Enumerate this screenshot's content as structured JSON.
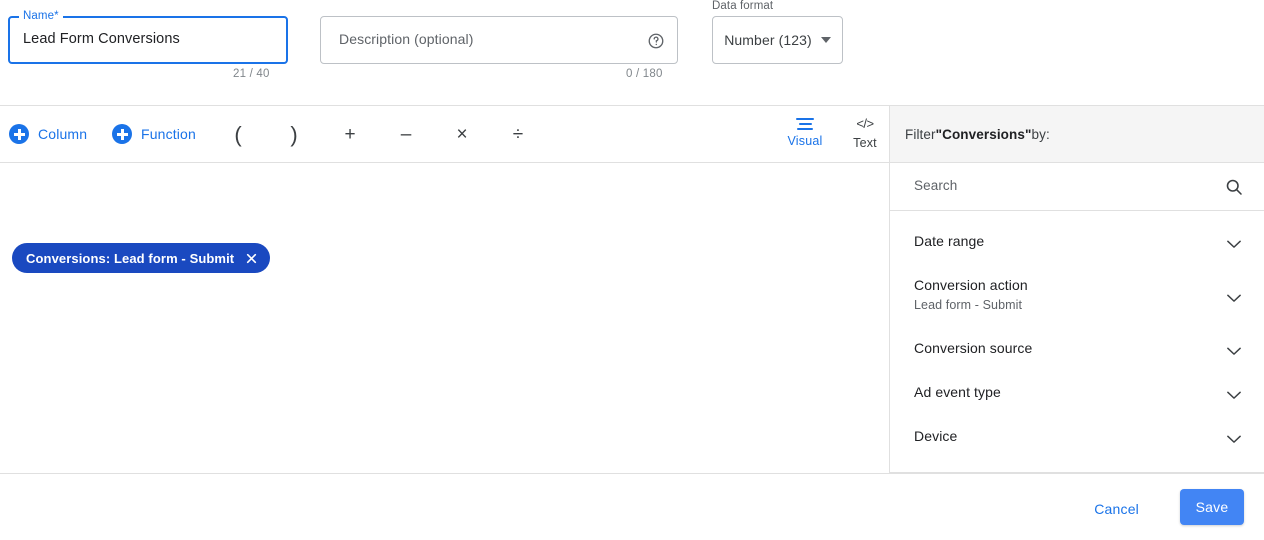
{
  "form": {
    "name_field": {
      "label": "Name*",
      "value": "Lead Form Conversions",
      "counter": "21 / 40"
    },
    "description_field": {
      "placeholder": "Description (optional)",
      "counter": "0 / 180",
      "help_icon": "help-circle-icon"
    },
    "data_format": {
      "label": "Data format",
      "selected": "Number (123)"
    }
  },
  "toolbar": {
    "add_column_label": "Column",
    "add_function_label": "Function",
    "operators": [
      "(",
      ")",
      "+",
      "–",
      "×",
      "÷"
    ],
    "modes": [
      {
        "label": "Visual",
        "icon": "visual-lines-icon",
        "active": true
      },
      {
        "label": "Text",
        "icon": "code-brackets-icon",
        "active": false
      }
    ]
  },
  "editor": {
    "chips": [
      {
        "label": "Conversions: Lead form - Submit",
        "remove_icon": "close-icon"
      }
    ]
  },
  "filter_panel": {
    "header_prefix": "Filter ",
    "header_subject": "\"Conversions\"",
    "header_suffix": " by:",
    "search": {
      "placeholder": "Search",
      "icon": "search-icon"
    },
    "items": [
      {
        "title": "Date range",
        "subtitle": ""
      },
      {
        "title": "Conversion action",
        "subtitle": "Lead form - Submit"
      },
      {
        "title": "Conversion source",
        "subtitle": ""
      },
      {
        "title": "Ad event type",
        "subtitle": ""
      },
      {
        "title": "Device",
        "subtitle": ""
      }
    ]
  },
  "footer": {
    "cancel_label": "Cancel",
    "save_label": "Save"
  },
  "colors": {
    "accent_blue": "#1a73e8",
    "save_blue": "#4285f4",
    "chip_blue": "#1a49c0",
    "text_primary": "#202124",
    "text_secondary": "#5f6368",
    "divider": "#e0e0e0",
    "panel_header_bg": "#f5f5f5"
  }
}
